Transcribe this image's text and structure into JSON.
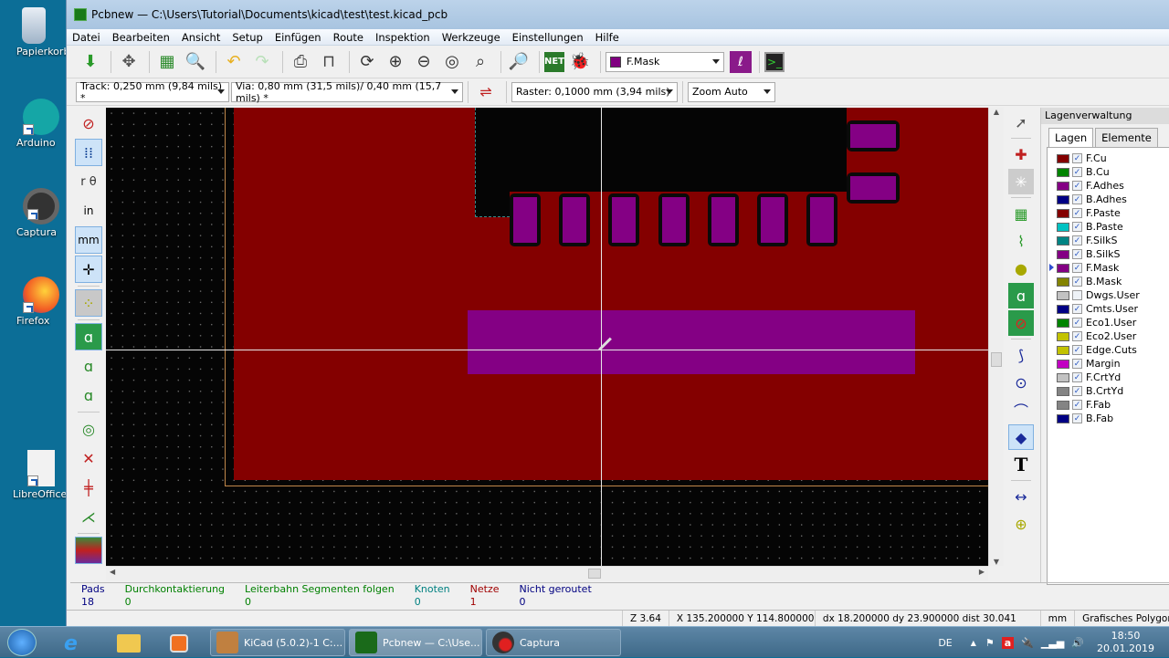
{
  "desktop": {
    "icons": [
      {
        "label": "Papierkorb",
        "icon": "recycle-bin-icon"
      },
      {
        "label": "Arduino",
        "icon": "arduino-icon"
      },
      {
        "label": "Captura",
        "icon": "captura-icon"
      },
      {
        "label": "Firefox",
        "icon": "firefox-icon"
      },
      {
        "label": "LibreOffice",
        "icon": "libreoffice-icon"
      }
    ]
  },
  "window": {
    "title": "Pcbnew — C:\\Users\\Tutorial\\Documents\\kicad\\test\\test.kicad_pcb"
  },
  "menu": [
    "Datei",
    "Bearbeiten",
    "Ansicht",
    "Setup",
    "Einfügen",
    "Route",
    "Inspektion",
    "Werkzeuge",
    "Einstellungen",
    "Hilfe"
  ],
  "toolbar": {
    "layer_select": "F.Mask",
    "layer_select_color": "#800080"
  },
  "toolbar2": {
    "track": "Track: 0,250 mm (9,84 mils) *",
    "via": "Via: 0,80 mm (31,5 mils)/ 0,40 mm (15,7 mils) *",
    "grid": "Raster: 0,1000 mm (3,94 mils)",
    "zoom": "Zoom Auto"
  },
  "layer_panel": {
    "title": "Lagenverwaltung",
    "tabs": [
      "Lagen",
      "Elemente"
    ],
    "active_tab": "Lagen",
    "active_layer": "F.Mask",
    "layers": [
      {
        "name": "F.Cu",
        "color": "#840000",
        "visible": true
      },
      {
        "name": "B.Cu",
        "color": "#008400",
        "visible": true
      },
      {
        "name": "F.Adhes",
        "color": "#840084",
        "visible": true
      },
      {
        "name": "B.Adhes",
        "color": "#000084",
        "visible": true
      },
      {
        "name": "F.Paste",
        "color": "#840000",
        "visible": true
      },
      {
        "name": "B.Paste",
        "color": "#00c2c2",
        "visible": true
      },
      {
        "name": "F.SilkS",
        "color": "#008484",
        "visible": true
      },
      {
        "name": "B.SilkS",
        "color": "#840084",
        "visible": true
      },
      {
        "name": "F.Mask",
        "color": "#840084",
        "visible": true
      },
      {
        "name": "B.Mask",
        "color": "#848400",
        "visible": true
      },
      {
        "name": "Dwgs.User",
        "color": "#c2c2c2",
        "visible": false
      },
      {
        "name": "Cmts.User",
        "color": "#000084",
        "visible": true
      },
      {
        "name": "Eco1.User",
        "color": "#008400",
        "visible": true
      },
      {
        "name": "Eco2.User",
        "color": "#c2c200",
        "visible": true
      },
      {
        "name": "Edge.Cuts",
        "color": "#c2c200",
        "visible": true
      },
      {
        "name": "Margin",
        "color": "#c200c2",
        "visible": true
      },
      {
        "name": "F.CrtYd",
        "color": "#c2c2c2",
        "visible": true
      },
      {
        "name": "B.CrtYd",
        "color": "#848484",
        "visible": true
      },
      {
        "name": "F.Fab",
        "color": "#848484",
        "visible": true
      },
      {
        "name": "B.Fab",
        "color": "#000084",
        "visible": true
      }
    ]
  },
  "message_panel": [
    {
      "label": "Pads",
      "value": "18",
      "color": "#000080"
    },
    {
      "label": "Durchkontaktierung",
      "value": "0",
      "color": "#008000"
    },
    {
      "label": "Leiterbahn Segmenten folgen",
      "value": "0",
      "color": "#008000"
    },
    {
      "label": "Knoten",
      "value": "0",
      "color": "#008080"
    },
    {
      "label": "Netze",
      "value": "1",
      "color": "#a00000"
    },
    {
      "label": "Nicht geroutet",
      "value": "0",
      "color": "#000080"
    }
  ],
  "status": {
    "zoom": "Z 3.64",
    "coords": "X 135.200000  Y 114.800000",
    "delta": "dx 18.200000  dy 23.900000  dist 30.041",
    "units": "mm",
    "mode": "Grafisches Polygon"
  },
  "taskbar": {
    "buttons": [
      {
        "label": "KiCad (5.0.2)-1 C:...",
        "icon": "kicad-icon"
      },
      {
        "label": "Pcbnew — C:\\Use...",
        "icon": "pcbnew-icon"
      },
      {
        "label": "Captura",
        "icon": "captura-icon"
      }
    ],
    "lang": "DE",
    "time": "18:50",
    "date": "20.01.2019"
  },
  "board": {
    "copper_color": "#840000",
    "mask_color": "#840084",
    "pad_count_bottom_row": 7,
    "pad_count_side": 2
  }
}
